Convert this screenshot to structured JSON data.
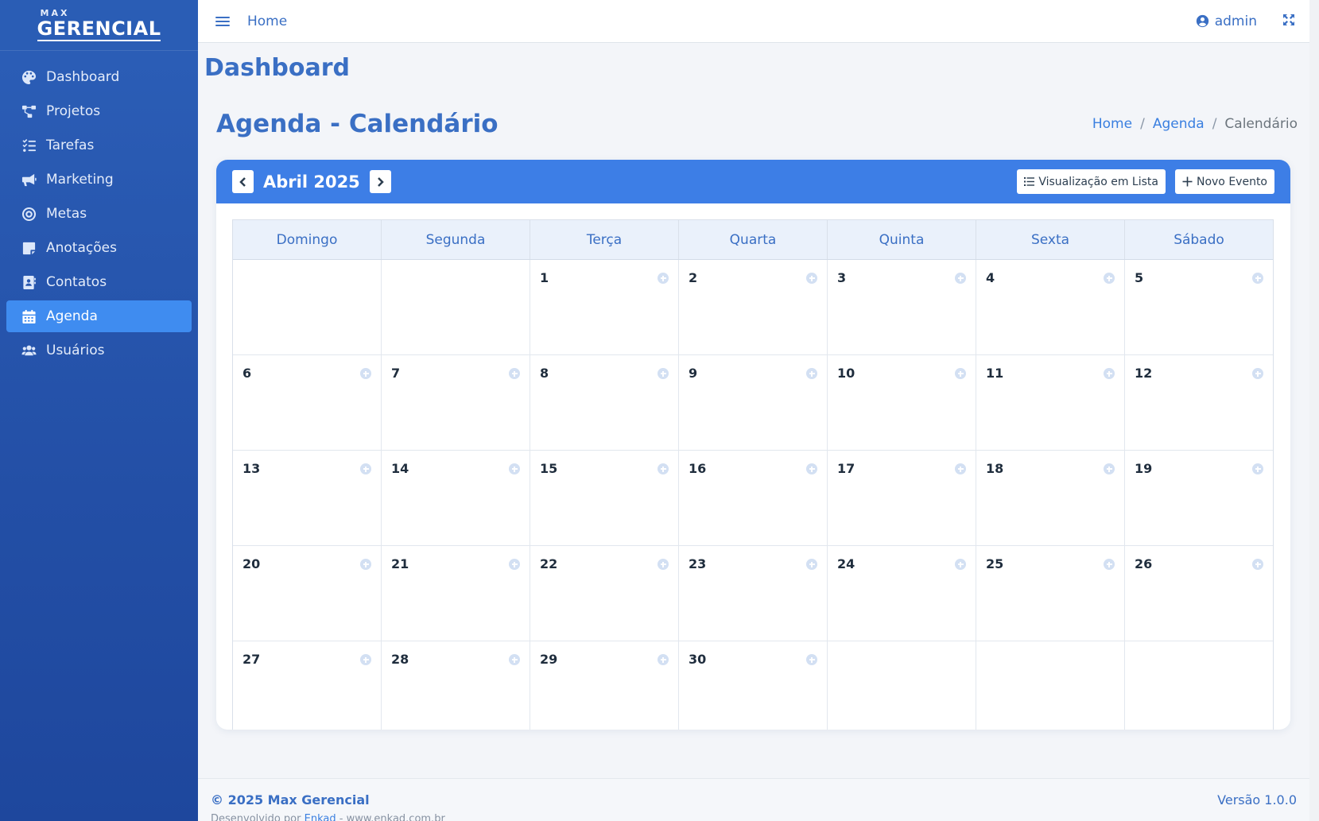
{
  "brand": {
    "small": "MAX",
    "big": "GERENCIAL"
  },
  "sidebar": {
    "items": [
      {
        "label": "Dashboard",
        "icon": "palette-icon"
      },
      {
        "label": "Projetos",
        "icon": "project-diagram-icon"
      },
      {
        "label": "Tarefas",
        "icon": "tasks-icon"
      },
      {
        "label": "Marketing",
        "icon": "bullhorn-icon"
      },
      {
        "label": "Metas",
        "icon": "target-icon"
      },
      {
        "label": "Anotações",
        "icon": "sticky-note-icon"
      },
      {
        "label": "Contatos",
        "icon": "address-book-icon"
      },
      {
        "label": "Agenda",
        "icon": "calendar-icon",
        "active": true
      },
      {
        "label": "Usuários",
        "icon": "users-icon"
      }
    ]
  },
  "topbar": {
    "home_label": "Home",
    "user_label": "admin"
  },
  "page": {
    "title": "Dashboard"
  },
  "section": {
    "title": "Agenda - Calendário"
  },
  "breadcrumb": {
    "items": [
      "Home",
      "Agenda"
    ],
    "current": "Calendário"
  },
  "calendar": {
    "month_label": "Abril 2025",
    "list_view_label": "Visualização em Lista",
    "new_event_label": "Novo Evento",
    "weekdays": [
      "Domingo",
      "Segunda",
      "Terça",
      "Quarta",
      "Quinta",
      "Sexta",
      "Sábado"
    ],
    "weeks": [
      [
        "",
        "",
        "1",
        "2",
        "3",
        "4",
        "5"
      ],
      [
        "6",
        "7",
        "8",
        "9",
        "10",
        "11",
        "12"
      ],
      [
        "13",
        "14",
        "15",
        "16",
        "17",
        "18",
        "19"
      ],
      [
        "20",
        "21",
        "22",
        "23",
        "24",
        "25",
        "26"
      ],
      [
        "27",
        "28",
        "29",
        "30",
        "",
        "",
        ""
      ]
    ]
  },
  "footer": {
    "copyright": "© 2025 Max Gerencial",
    "developed_by": "Desenvolvido por",
    "developer": "Enkad",
    "developer_site": "- www.enkad.com.br",
    "version": "Versão 1.0.0"
  },
  "colors": {
    "primary": "#3a6fc4",
    "header_blue": "#3d7ee6",
    "sidebar_active": "#3f8cf0"
  }
}
